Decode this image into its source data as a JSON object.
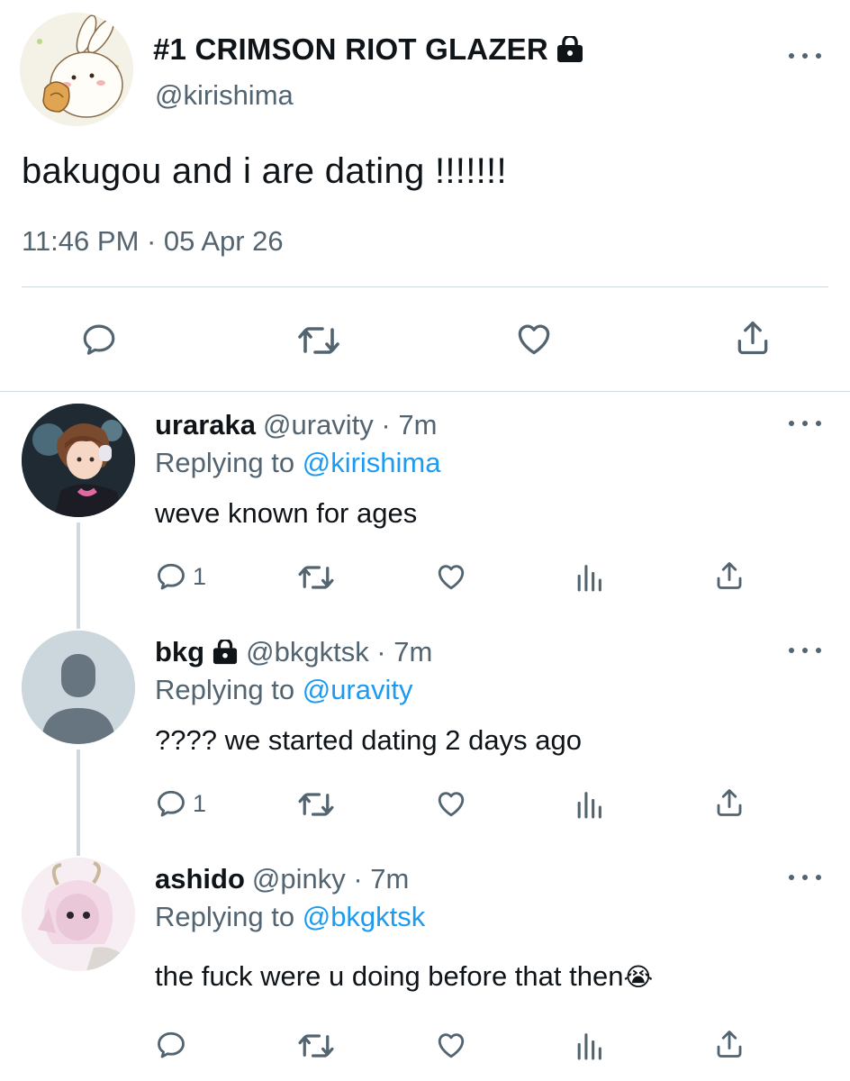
{
  "main_tweet": {
    "display_name": "#1 CRIMSON RIOT GLAZER",
    "handle": "@kirishima",
    "text": "bakugou and i are dating !!!!!!!",
    "timestamp": "11:46 PM · 05 Apr 26",
    "avatar_icon": "bunny-avatar",
    "locked_icon": "lock-icon"
  },
  "replies": [
    {
      "name": "uraraka",
      "meta": "@uravity · 7m",
      "replying_prefix": "Replying to",
      "replying_to": "@kirishima",
      "text": "weve known for ages",
      "reply_count": "1",
      "avatar_icon": "uraraka-avatar"
    },
    {
      "name": "bkg",
      "meta": "@bkgktsk · 7m",
      "replying_prefix": "Replying to",
      "replying_to": "@uravity",
      "text": "???? we started dating 2 days ago",
      "reply_count": "1",
      "avatar_icon": "default-avatar"
    },
    {
      "name": "ashido",
      "meta": "@pinky · 7m",
      "replying_prefix": "Replying to",
      "replying_to": "@bkgktsk",
      "text": "the fuck were u doing before that then",
      "emoji": "😭",
      "avatar_icon": "ashido-avatar"
    }
  ],
  "colors": {
    "text": "#0f1419",
    "secondary": "#536471",
    "link": "#1d9bf0",
    "divider": "#cfd9de"
  }
}
